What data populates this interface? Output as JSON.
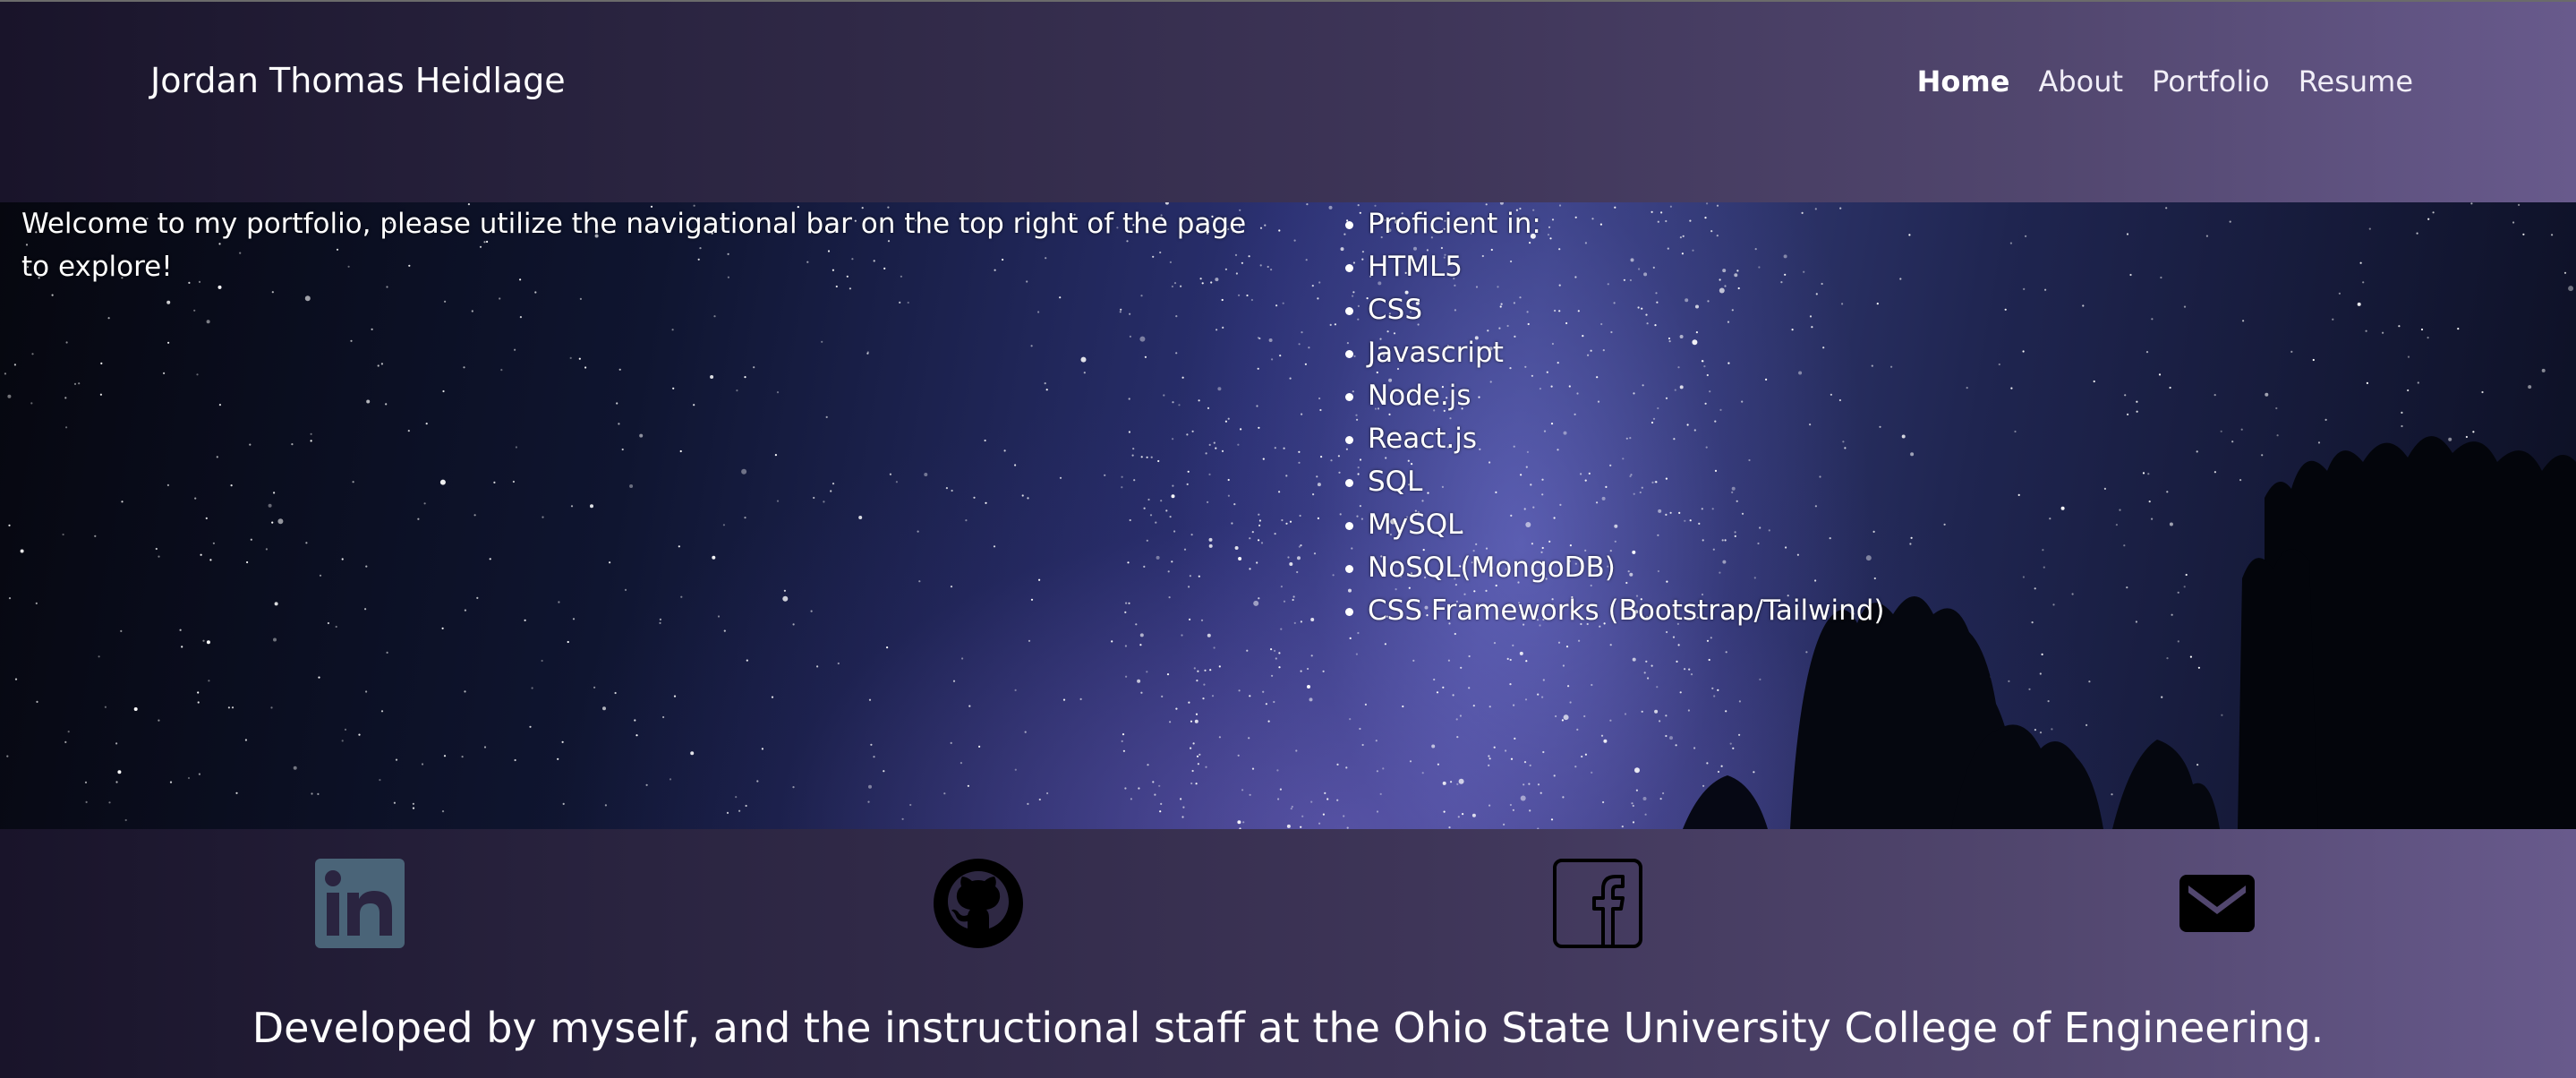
{
  "header": {
    "name": "Jordan Thomas Heidlage",
    "nav": [
      {
        "label": "Home",
        "active": true
      },
      {
        "label": "About",
        "active": false
      },
      {
        "label": "Portfolio",
        "active": false
      },
      {
        "label": "Resume",
        "active": false
      }
    ]
  },
  "hero": {
    "welcome_text": "Welcome to my portfolio, please utilize the navigational bar on the top right of the page to explore!",
    "skills": [
      "Proficient in:",
      "HTML5",
      "CSS",
      "Javascript",
      "Node.js",
      "React.js",
      "SQL",
      "MySQL",
      "NoSQL(MongoDB)",
      "CSS Frameworks (Bootstrap/Tailwind)"
    ]
  },
  "footer": {
    "social": [
      {
        "name": "linkedin-icon",
        "color": "#4a6478"
      },
      {
        "name": "github-icon",
        "color": "#000000"
      },
      {
        "name": "facebook-icon",
        "color": "#000000"
      },
      {
        "name": "email-icon",
        "color": "#000000"
      }
    ],
    "credit": "Developed by myself, and the instructional staff at the Ohio State University College of Engineering."
  },
  "colors": {
    "header_gradient_start": "#19142a",
    "header_gradient_end": "#685a8c",
    "text": "#ffffff"
  }
}
